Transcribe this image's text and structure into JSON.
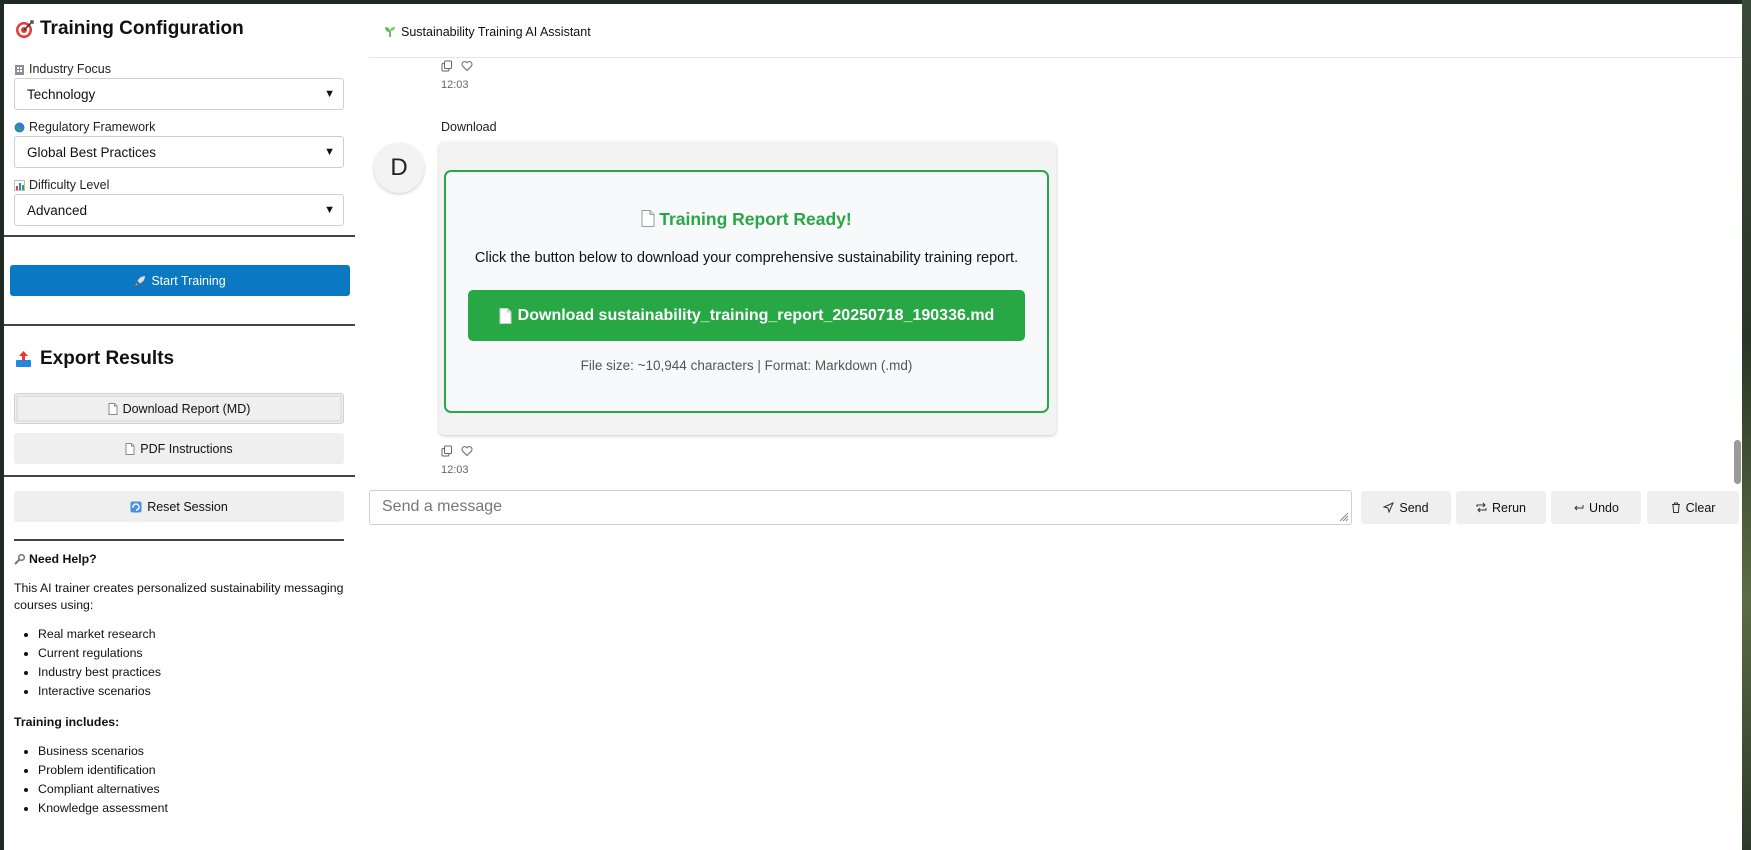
{
  "sidebar": {
    "title": "Training Configuration",
    "industry": {
      "label": "Industry Focus",
      "value": "Technology"
    },
    "framework": {
      "label": "Regulatory Framework",
      "value": "Global Best Practices"
    },
    "difficulty": {
      "label": "Difficulty Level",
      "value": "Advanced"
    },
    "start_button": "Start Training",
    "export_title": "Export Results",
    "download_report": "Download Report (MD)",
    "pdf_instructions": "PDF Instructions",
    "reset_session": "Reset Session",
    "help": {
      "title": "Need Help?",
      "intro": "This AI trainer creates personalized sustainability messaging courses using:",
      "sources": [
        "Real market research",
        "Current regulations",
        "Industry best practices",
        "Interactive scenarios"
      ],
      "includes_title": "Training includes:",
      "includes": [
        "Business scenarios",
        "Problem identification",
        "Compliant alternatives",
        "Knowledge assessment"
      ]
    }
  },
  "main": {
    "title": "Sustainability Training AI Assistant",
    "prev_time": "12:03",
    "message": {
      "sender": "Download",
      "avatar_letter": "D",
      "card_title": "Training Report Ready!",
      "card_desc": "Click the button below to download your comprehensive sustainability training report.",
      "download_button": "Download sustainability_training_report_20250718_190336.md",
      "meta": "File size: ~10,944 characters | Format: Markdown (.md)",
      "time": "12:03"
    },
    "composer_placeholder": "Send a message",
    "buttons": {
      "send": "Send",
      "rerun": "Rerun",
      "undo": "Undo",
      "clear": "Clear"
    }
  },
  "colors": {
    "primary": "#0a78c2",
    "success": "#28a745"
  }
}
